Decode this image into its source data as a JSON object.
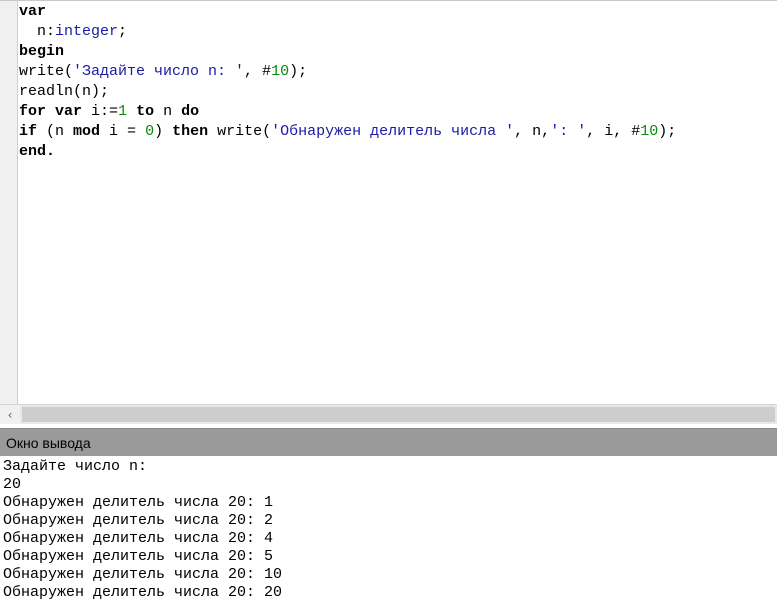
{
  "editor": {
    "lines": [
      [
        {
          "t": "var",
          "c": "kw"
        }
      ],
      [
        {
          "t": "  n:",
          "c": ""
        },
        {
          "t": "integer",
          "c": "type"
        },
        {
          "t": ";",
          "c": ""
        }
      ],
      [
        {
          "t": "begin",
          "c": "kw"
        }
      ],
      [
        {
          "t": "write(",
          "c": ""
        },
        {
          "t": "'Задайте число n: '",
          "c": "str"
        },
        {
          "t": ", #",
          "c": ""
        },
        {
          "t": "10",
          "c": "num"
        },
        {
          "t": ");",
          "c": ""
        }
      ],
      [
        {
          "t": "readln(n);",
          "c": ""
        }
      ],
      [
        {
          "t": "for",
          "c": "kw"
        },
        {
          "t": " ",
          "c": ""
        },
        {
          "t": "var",
          "c": "kw"
        },
        {
          "t": " i:=",
          "c": ""
        },
        {
          "t": "1",
          "c": "num"
        },
        {
          "t": " ",
          "c": ""
        },
        {
          "t": "to",
          "c": "kw"
        },
        {
          "t": " n ",
          "c": ""
        },
        {
          "t": "do",
          "c": "kw"
        }
      ],
      [
        {
          "t": "if",
          "c": "kw"
        },
        {
          "t": " (n ",
          "c": ""
        },
        {
          "t": "mod",
          "c": "kw"
        },
        {
          "t": " i = ",
          "c": ""
        },
        {
          "t": "0",
          "c": "num"
        },
        {
          "t": ") ",
          "c": ""
        },
        {
          "t": "then",
          "c": "kw"
        },
        {
          "t": " write(",
          "c": ""
        },
        {
          "t": "'Обнаружен делитель числа '",
          "c": "str"
        },
        {
          "t": ", n,",
          "c": ""
        },
        {
          "t": "': '",
          "c": "str"
        },
        {
          "t": ", i, #",
          "c": ""
        },
        {
          "t": "10",
          "c": "num"
        },
        {
          "t": ");",
          "c": ""
        }
      ],
      [
        {
          "t": "end.",
          "c": "kw"
        }
      ]
    ]
  },
  "scrollbar": {
    "left_arrow": "‹"
  },
  "output_panel": {
    "title": "Окно вывода",
    "lines": [
      "Задайте число n:",
      "20",
      "Обнаружен делитель числа 20: 1",
      "Обнаружен делитель числа 20: 2",
      "Обнаружен делитель числа 20: 4",
      "Обнаружен делитель числа 20: 5",
      "Обнаружен делитель числа 20: 10",
      "Обнаружен делитель числа 20: 20"
    ]
  }
}
